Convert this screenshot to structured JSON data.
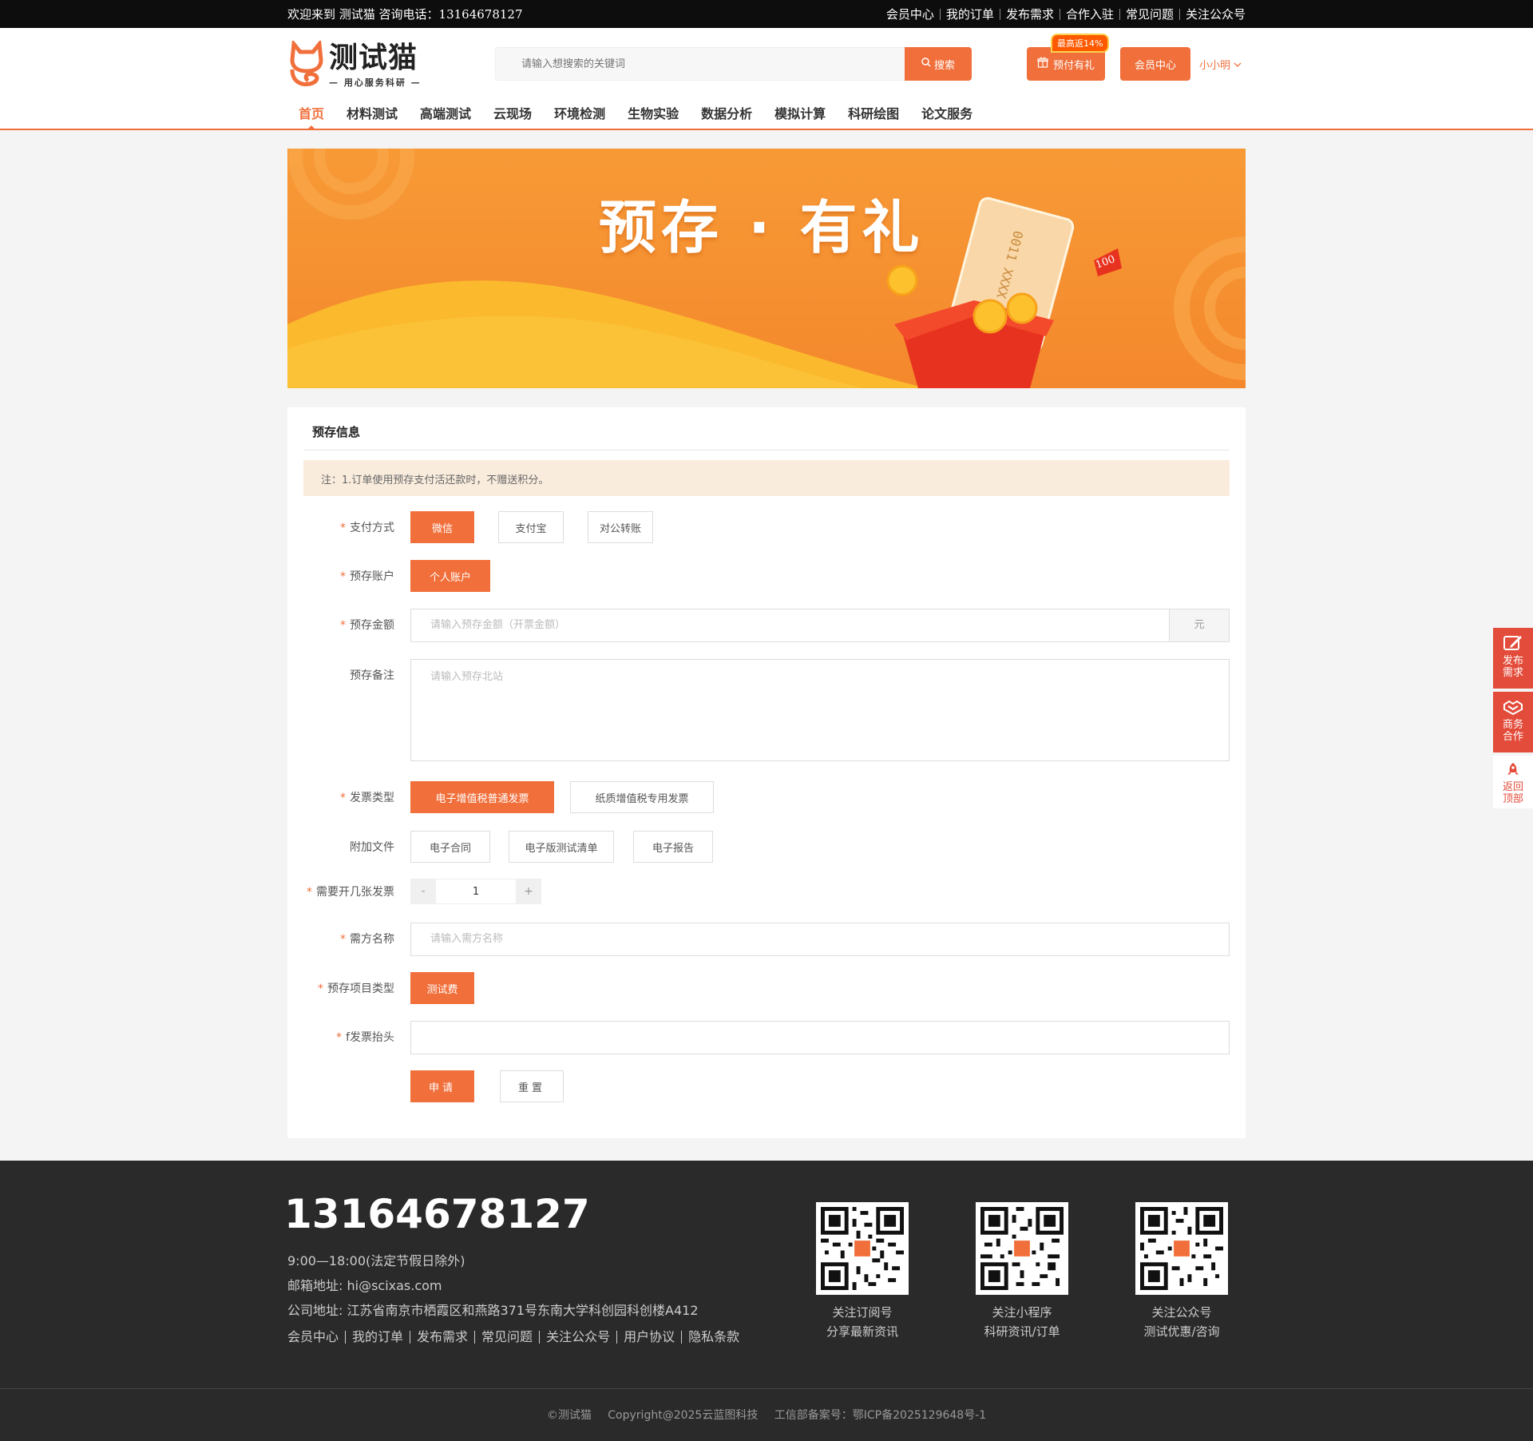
{
  "topbar": {
    "welcome": "欢迎来到 测试猫 咨询电话：13164678127",
    "links": [
      "会员中心",
      "我的订单",
      "发布需求",
      "合作入驻",
      "常见问题",
      "关注公众号"
    ]
  },
  "header": {
    "logo_title": "测试猫",
    "logo_sub": "— 用心服务科研 —",
    "search_placeholder": "请输入想搜索的关键词",
    "search_button": "搜索",
    "prepay_button": "预付有礼",
    "prepay_badge": "最高返14%",
    "member_button": "会员中心",
    "user_name": "小小明"
  },
  "nav": [
    "首页",
    "材料测试",
    "高端测试",
    "云现场",
    "环境检测",
    "生物实验",
    "数据分析",
    "模拟计算",
    "科研绘图",
    "论文服务"
  ],
  "banner": {
    "title": "预存 · 有礼",
    "card_number": "0011 XXXX XXXX",
    "tag": "100"
  },
  "form": {
    "title": "预存信息",
    "notice": "注：1.订单使用预存支付活还款时，不赠送积分。",
    "pay_label": "支付方式",
    "pay_options": [
      "微信",
      "支付宝",
      "对公转账"
    ],
    "account_label": "预存账户",
    "account_option": "个人账户",
    "amount_label": "预存金额",
    "amount_placeholder": "请输入预存金额（开票金额）",
    "amount_unit": "元",
    "remark_label": "预存备注",
    "remark_placeholder": "请输入预存北站",
    "invoice_label": "发票类型",
    "invoice_options": [
      "电子增值税普通发票",
      "纸质增值税专用发票"
    ],
    "attach_label": "附加文件",
    "attach_options": [
      "电子合同",
      "电子版测试清单",
      "电子报告"
    ],
    "count_label": "需要开几张发票",
    "count_minus": "-",
    "count_value": "1",
    "count_plus": "+",
    "buyer_label": "需方名称",
    "buyer_placeholder": "请输入需方名称",
    "project_label": "预存项目类型",
    "project_option": "测试费",
    "header_label": "f发票抬头",
    "apply_button": "申请",
    "reset_button": "重置"
  },
  "footer": {
    "phone": "13164678127",
    "hours": "9:00—18:00(法定节假日除外)",
    "email": "邮箱地址:   hi@scixas.com",
    "address": "公司地址:   江苏省南京市栖霞区和燕路371号东南大学科创园科创楼A412",
    "links": [
      "会员中心",
      "我的订单",
      "发布需求",
      "常见问题",
      "关注公众号",
      "用户协议",
      "隐私条款"
    ],
    "qr": [
      {
        "line1": "关注订阅号",
        "line2": "分享最新资讯"
      },
      {
        "line1": "关注小程序",
        "line2": "科研资讯/订单"
      },
      {
        "line1": "关注公众号",
        "line2": "测试优惠/咨询"
      }
    ],
    "copyright": "©测试猫",
    "copyright2": "Copyright@2025云蓝图科技",
    "icp": "工信部备案号：鄂ICP备2025129648号-1"
  },
  "side": {
    "publish": "发布需求",
    "business": "商务合作",
    "top": "返回顶部"
  },
  "colors": {
    "accent": "#f16f3b",
    "side": "#e34b3a",
    "footer_bg": "#2a2a2a"
  }
}
